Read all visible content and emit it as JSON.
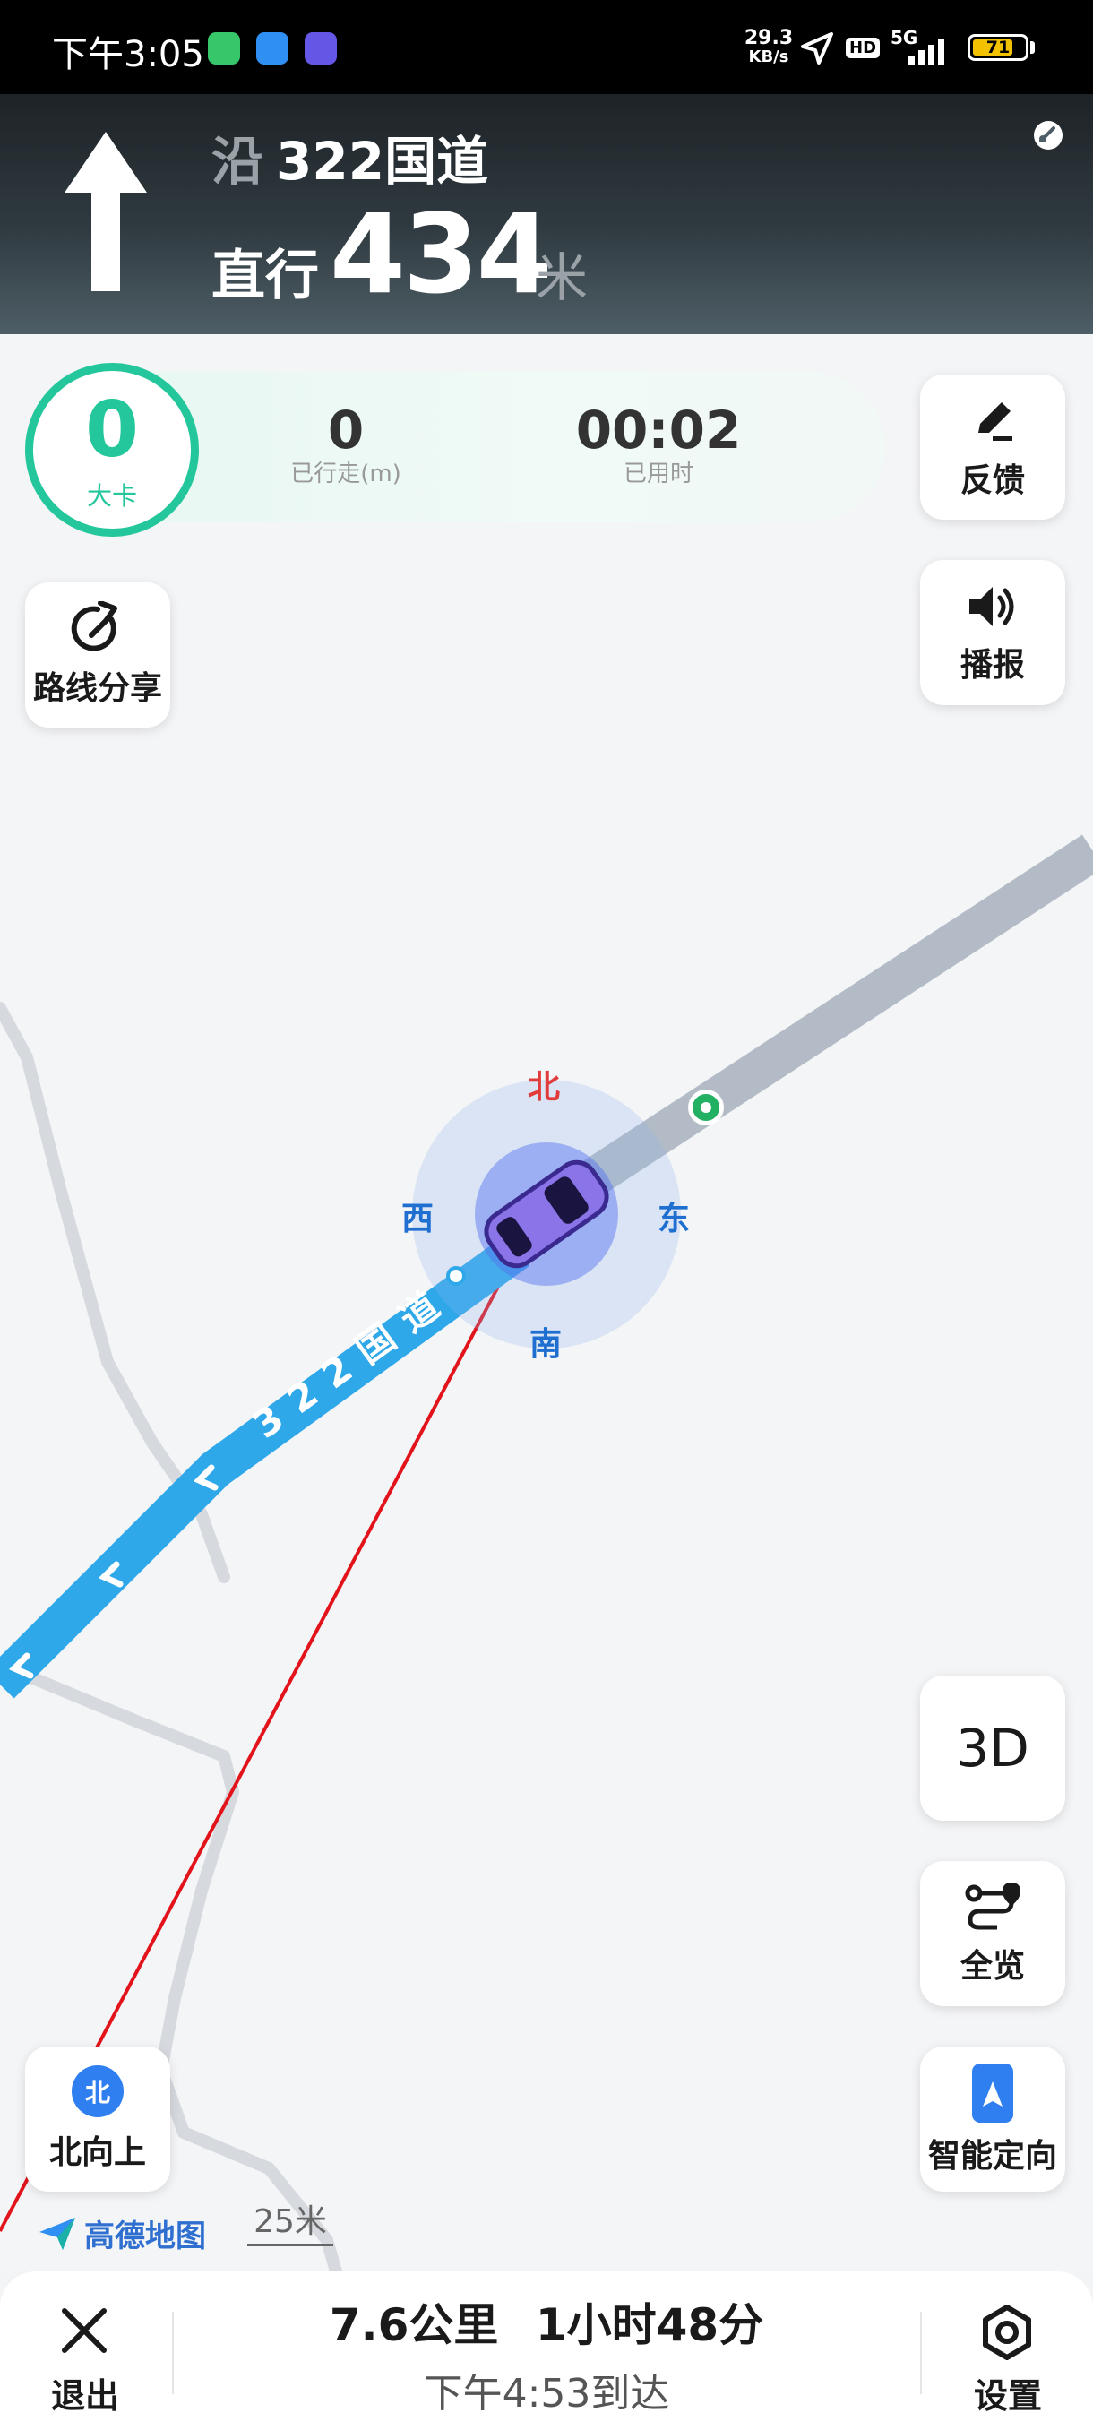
{
  "status_bar": {
    "time": "下午3:05",
    "net_speed_value": "29.3",
    "net_speed_unit": "KB/s",
    "hd_label": "HD",
    "network_label": "5G",
    "battery_level": "71"
  },
  "guidance": {
    "road_prefix": "沿",
    "road_name": "322国道",
    "action": "直行",
    "distance": "434",
    "distance_unit": "米"
  },
  "stats": {
    "speed": "0",
    "speed_label": "大卡",
    "traveled_value": "0",
    "traveled_label": "已行走(m)",
    "time_value": "00:02",
    "time_label": "已用时"
  },
  "buttons": {
    "feedback": "反馈",
    "broadcast": "播报",
    "route_share": "路线分享",
    "three_d": "3D",
    "overview": "全览",
    "north_up": "北向上",
    "north_badge": "北",
    "smart_orient": "智能定向"
  },
  "compass": {
    "north": "北",
    "east": "东",
    "south": "南",
    "west": "西"
  },
  "map": {
    "road_label": "322国道",
    "brand": "高德地图",
    "scale": "25米"
  },
  "bottom": {
    "exit": "退出",
    "distance_remaining": "7.6公里",
    "time_remaining": "1小时48分",
    "arrival": "下午4:53到达",
    "settings": "设置"
  },
  "colors": {
    "route_blue": "#2fa8ea",
    "accent_green": "#23c79b",
    "compass_north": "#e23b3b",
    "compass_other": "#1f6fd0",
    "header_dark": "#1e2327",
    "trail_red": "#e2131a"
  }
}
